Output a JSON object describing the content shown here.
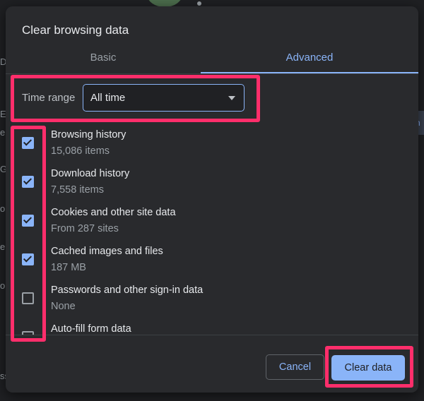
{
  "background": {
    "edge_letters": [
      "D",
      "E",
      "e",
      "G",
      "o",
      "e",
      "o",
      "ss"
    ],
    "right_tab_text": "n"
  },
  "dialog": {
    "title": "Clear browsing data",
    "tabs": [
      {
        "label": "Basic",
        "active": false
      },
      {
        "label": "Advanced",
        "active": true
      }
    ],
    "time_range": {
      "label": "Time range",
      "selected": "All time"
    },
    "items": [
      {
        "title": "Browsing history",
        "subtitle": "15,086 items",
        "checked": true
      },
      {
        "title": "Download history",
        "subtitle": "7,558 items",
        "checked": true
      },
      {
        "title": "Cookies and other site data",
        "subtitle": "From 287 sites",
        "checked": true
      },
      {
        "title": "Cached images and files",
        "subtitle": "187 MB",
        "checked": true
      },
      {
        "title": "Passwords and other sign-in data",
        "subtitle": "None",
        "checked": false
      },
      {
        "title": "Auto-fill form data",
        "subtitle": "",
        "checked": false
      }
    ],
    "buttons": {
      "cancel": "Cancel",
      "clear": "Clear data"
    }
  },
  "colors": {
    "accent": "#8ab4f8",
    "highlight": "#ff2e6b",
    "dialog_bg": "#292a2d"
  }
}
